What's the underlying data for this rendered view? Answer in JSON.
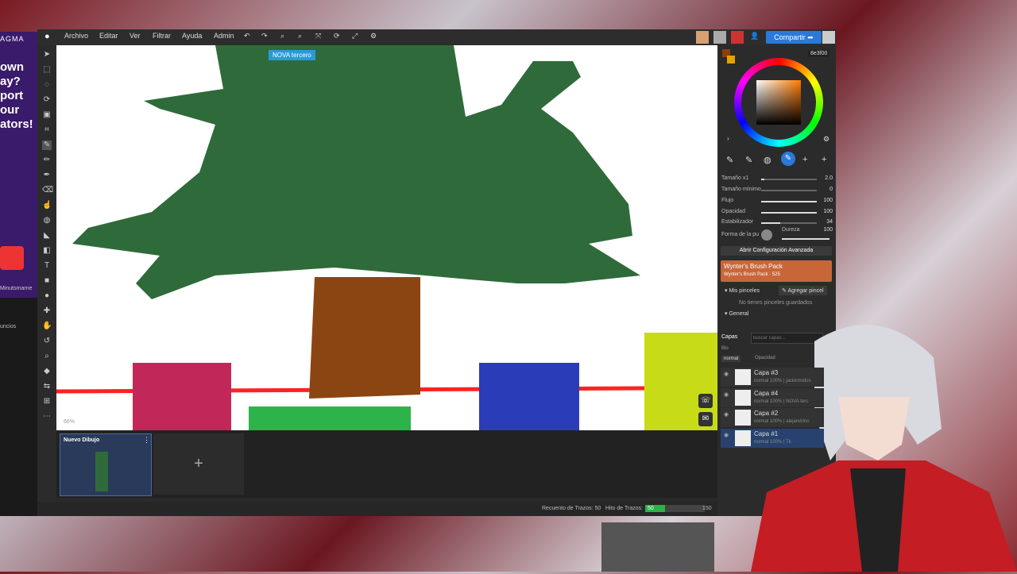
{
  "ad": {
    "brand": "AGMA",
    "text": "own\nay?\nport\nour\nators!",
    "small": "Minutsmarne",
    "anuncios": "uncios"
  },
  "menu": {
    "items": [
      "Archivo",
      "Editar",
      "Ver",
      "Filtrar",
      "Ayuda",
      "Admin"
    ],
    "share_label": "Compartir"
  },
  "canvas": {
    "tooltip": "NOVA tercero",
    "zoom": "66%"
  },
  "color": {
    "hex": "8e3f00",
    "accent": "#8e3f00"
  },
  "brush": {
    "rows": [
      {
        "label": "Tamaño x1",
        "value": "2.0",
        "fill": 0.05
      },
      {
        "label": "Tamaño mínimo",
        "value": "0",
        "fill": 0.0
      },
      {
        "label": "Flujo",
        "value": "100",
        "fill": 1.0
      },
      {
        "label": "Opacidad",
        "value": "100",
        "fill": 1.0
      },
      {
        "label": "Estabilizador",
        "value": "34",
        "fill": 0.34
      }
    ],
    "shape_label": "Forma de la pu",
    "hardness_label": "Dureza",
    "hardness_value": "100",
    "advanced": "Abrir Configuración Avanzada",
    "pack_title": "Wynter's Brush Pack",
    "pack_sub": "Wynter's Brush Pack · 525",
    "my_brushes": "Mis pinceles",
    "add_brush": "Agregar pincel",
    "empty": "No tienes pinceles guardados",
    "general": "General"
  },
  "layers": {
    "title": "Capas",
    "search_placeholder": "buscar capas...",
    "blend": "normal",
    "opacity_label": "Opacidad",
    "items": [
      {
        "name": "Capa #3",
        "sub": "normal 100% | jackinmidos"
      },
      {
        "name": "Capa #4",
        "sub": "normal 100% | NOVA terc"
      },
      {
        "name": "Capa #2",
        "sub": "normal 100% | alejandrino"
      },
      {
        "name": "Capa #1",
        "sub": "normal 100% | Tk"
      }
    ],
    "blo": "Blo"
  },
  "document": {
    "title": "Nuevo Dibujo"
  },
  "status": {
    "strokes_label": "Recuento de Trazos: 50",
    "milestone_label": "Hito de Trazos:",
    "progress": "50",
    "goal": "150",
    "progress_fraction": 0.333
  }
}
